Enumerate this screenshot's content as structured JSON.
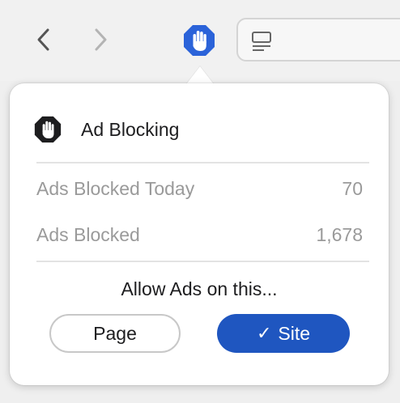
{
  "toolbar": {
    "back_icon": "chevron-left-icon",
    "forward_icon": "chevron-right-icon",
    "extension_icon": "hand-stop-icon",
    "reader_icon": "reader-view-icon",
    "accent_color": "#2b63d9"
  },
  "popover": {
    "title": "Ad Blocking",
    "title_icon": "hand-stop-octagon-icon",
    "stats": [
      {
        "label": "Ads Blocked Today",
        "value": "70"
      },
      {
        "label": "Ads Blocked",
        "value": "1,678"
      }
    ],
    "allow_label": "Allow Ads on this...",
    "buttons": {
      "page_label": "Page",
      "site_label": "Site",
      "site_check": "✓",
      "selected": "site"
    }
  }
}
